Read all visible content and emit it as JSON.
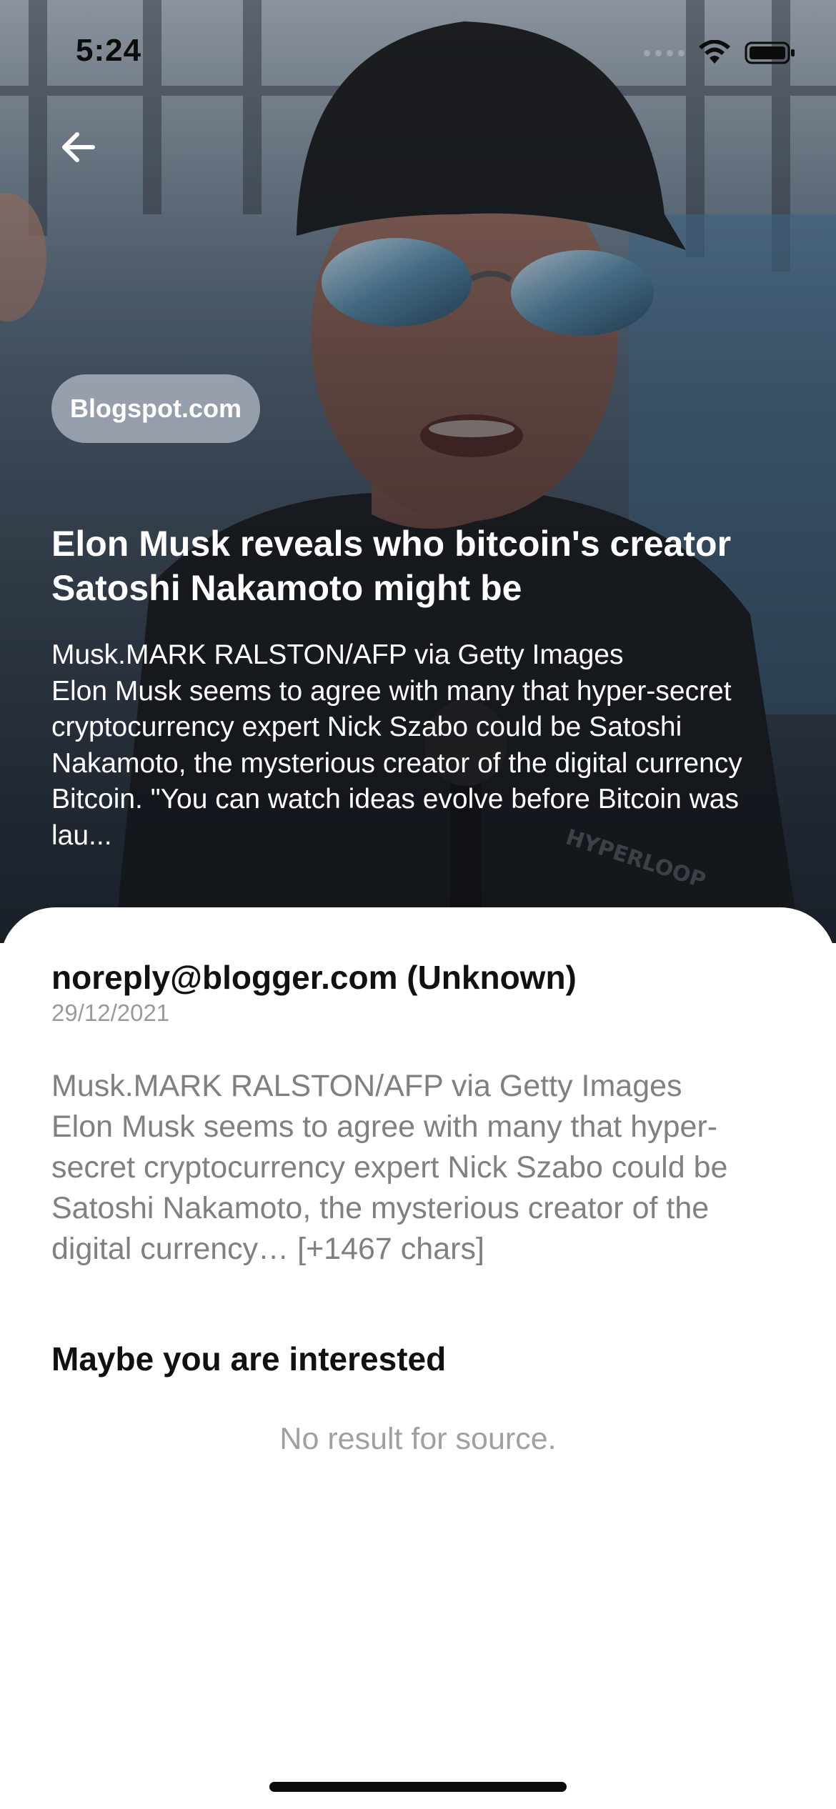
{
  "status_bar": {
    "time": "5:24",
    "icons": [
      "signal-dots",
      "wifi-icon",
      "battery-icon"
    ]
  },
  "header": {
    "back_icon": "arrow-left-icon"
  },
  "article": {
    "source": "Blogspot.com",
    "title": "Elon Musk reveals who bitcoin's creator Satoshi Nakamoto might be",
    "description": "Musk.MARK RALSTON/AFP via Getty Images\nElon Musk seems to agree with many that hyper-secret cryptocurrency expert Nick Szabo could be Satoshi Nakamoto, the mysterious creator of the digital currency Bitcoin. \"You can watch ideas evolve before Bitcoin was lau...",
    "author": "noreply@blogger.com (Unknown)",
    "date": "29/12/2021",
    "content": "Musk.MARK RALSTON/AFP via Getty Images\nElon Musk seems to agree with many that hyper-secret cryptocurrency expert Nick Szabo could be Satoshi Nakamoto, the mysterious creator of the digital currency… [+1467 chars]"
  },
  "related": {
    "heading": "Maybe you are interested",
    "empty_message": "No result for source."
  },
  "colors": {
    "sheet_background": "#ffffff",
    "chip_background": "#cdd4de",
    "body_text": "#808080",
    "meta_text": "#9a9a9a"
  }
}
